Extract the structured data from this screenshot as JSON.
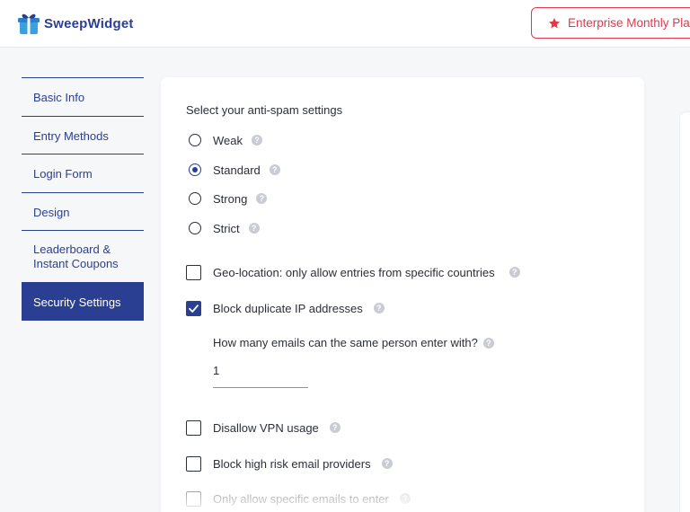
{
  "header": {
    "logo_text": "SweepWidget",
    "plan_label": "Enterprise Monthly Plan",
    "brand_color": "#2a3f92",
    "plan_color": "#e2384d"
  },
  "sidebar": {
    "items": [
      {
        "label": "Basic Info",
        "active": false
      },
      {
        "label": "Entry Methods",
        "active": false
      },
      {
        "label": "Login Form",
        "active": false
      },
      {
        "label": "Design",
        "active": false
      },
      {
        "label": "Leaderboard & Instant Coupons",
        "active": false
      },
      {
        "label": "Security Settings",
        "active": true
      }
    ]
  },
  "main": {
    "anti_spam_title": "Select your anti-spam settings",
    "anti_spam_options": [
      {
        "label": "Weak",
        "selected": false
      },
      {
        "label": "Standard",
        "selected": true
      },
      {
        "label": "Strong",
        "selected": false
      },
      {
        "label": "Strict",
        "selected": false
      }
    ],
    "checkboxes": [
      {
        "label": "Geo-location: only allow entries from specific countries",
        "checked": false
      },
      {
        "label": "Block duplicate IP addresses",
        "checked": true
      },
      {
        "label": "Disallow VPN usage",
        "checked": false
      },
      {
        "label": "Block high risk email providers",
        "checked": false
      },
      {
        "label": "Only allow specific emails to enter",
        "checked": false
      }
    ],
    "emails_question": "How many emails can the same person enter with?",
    "emails_value": "1",
    "help_glyph": "?"
  }
}
